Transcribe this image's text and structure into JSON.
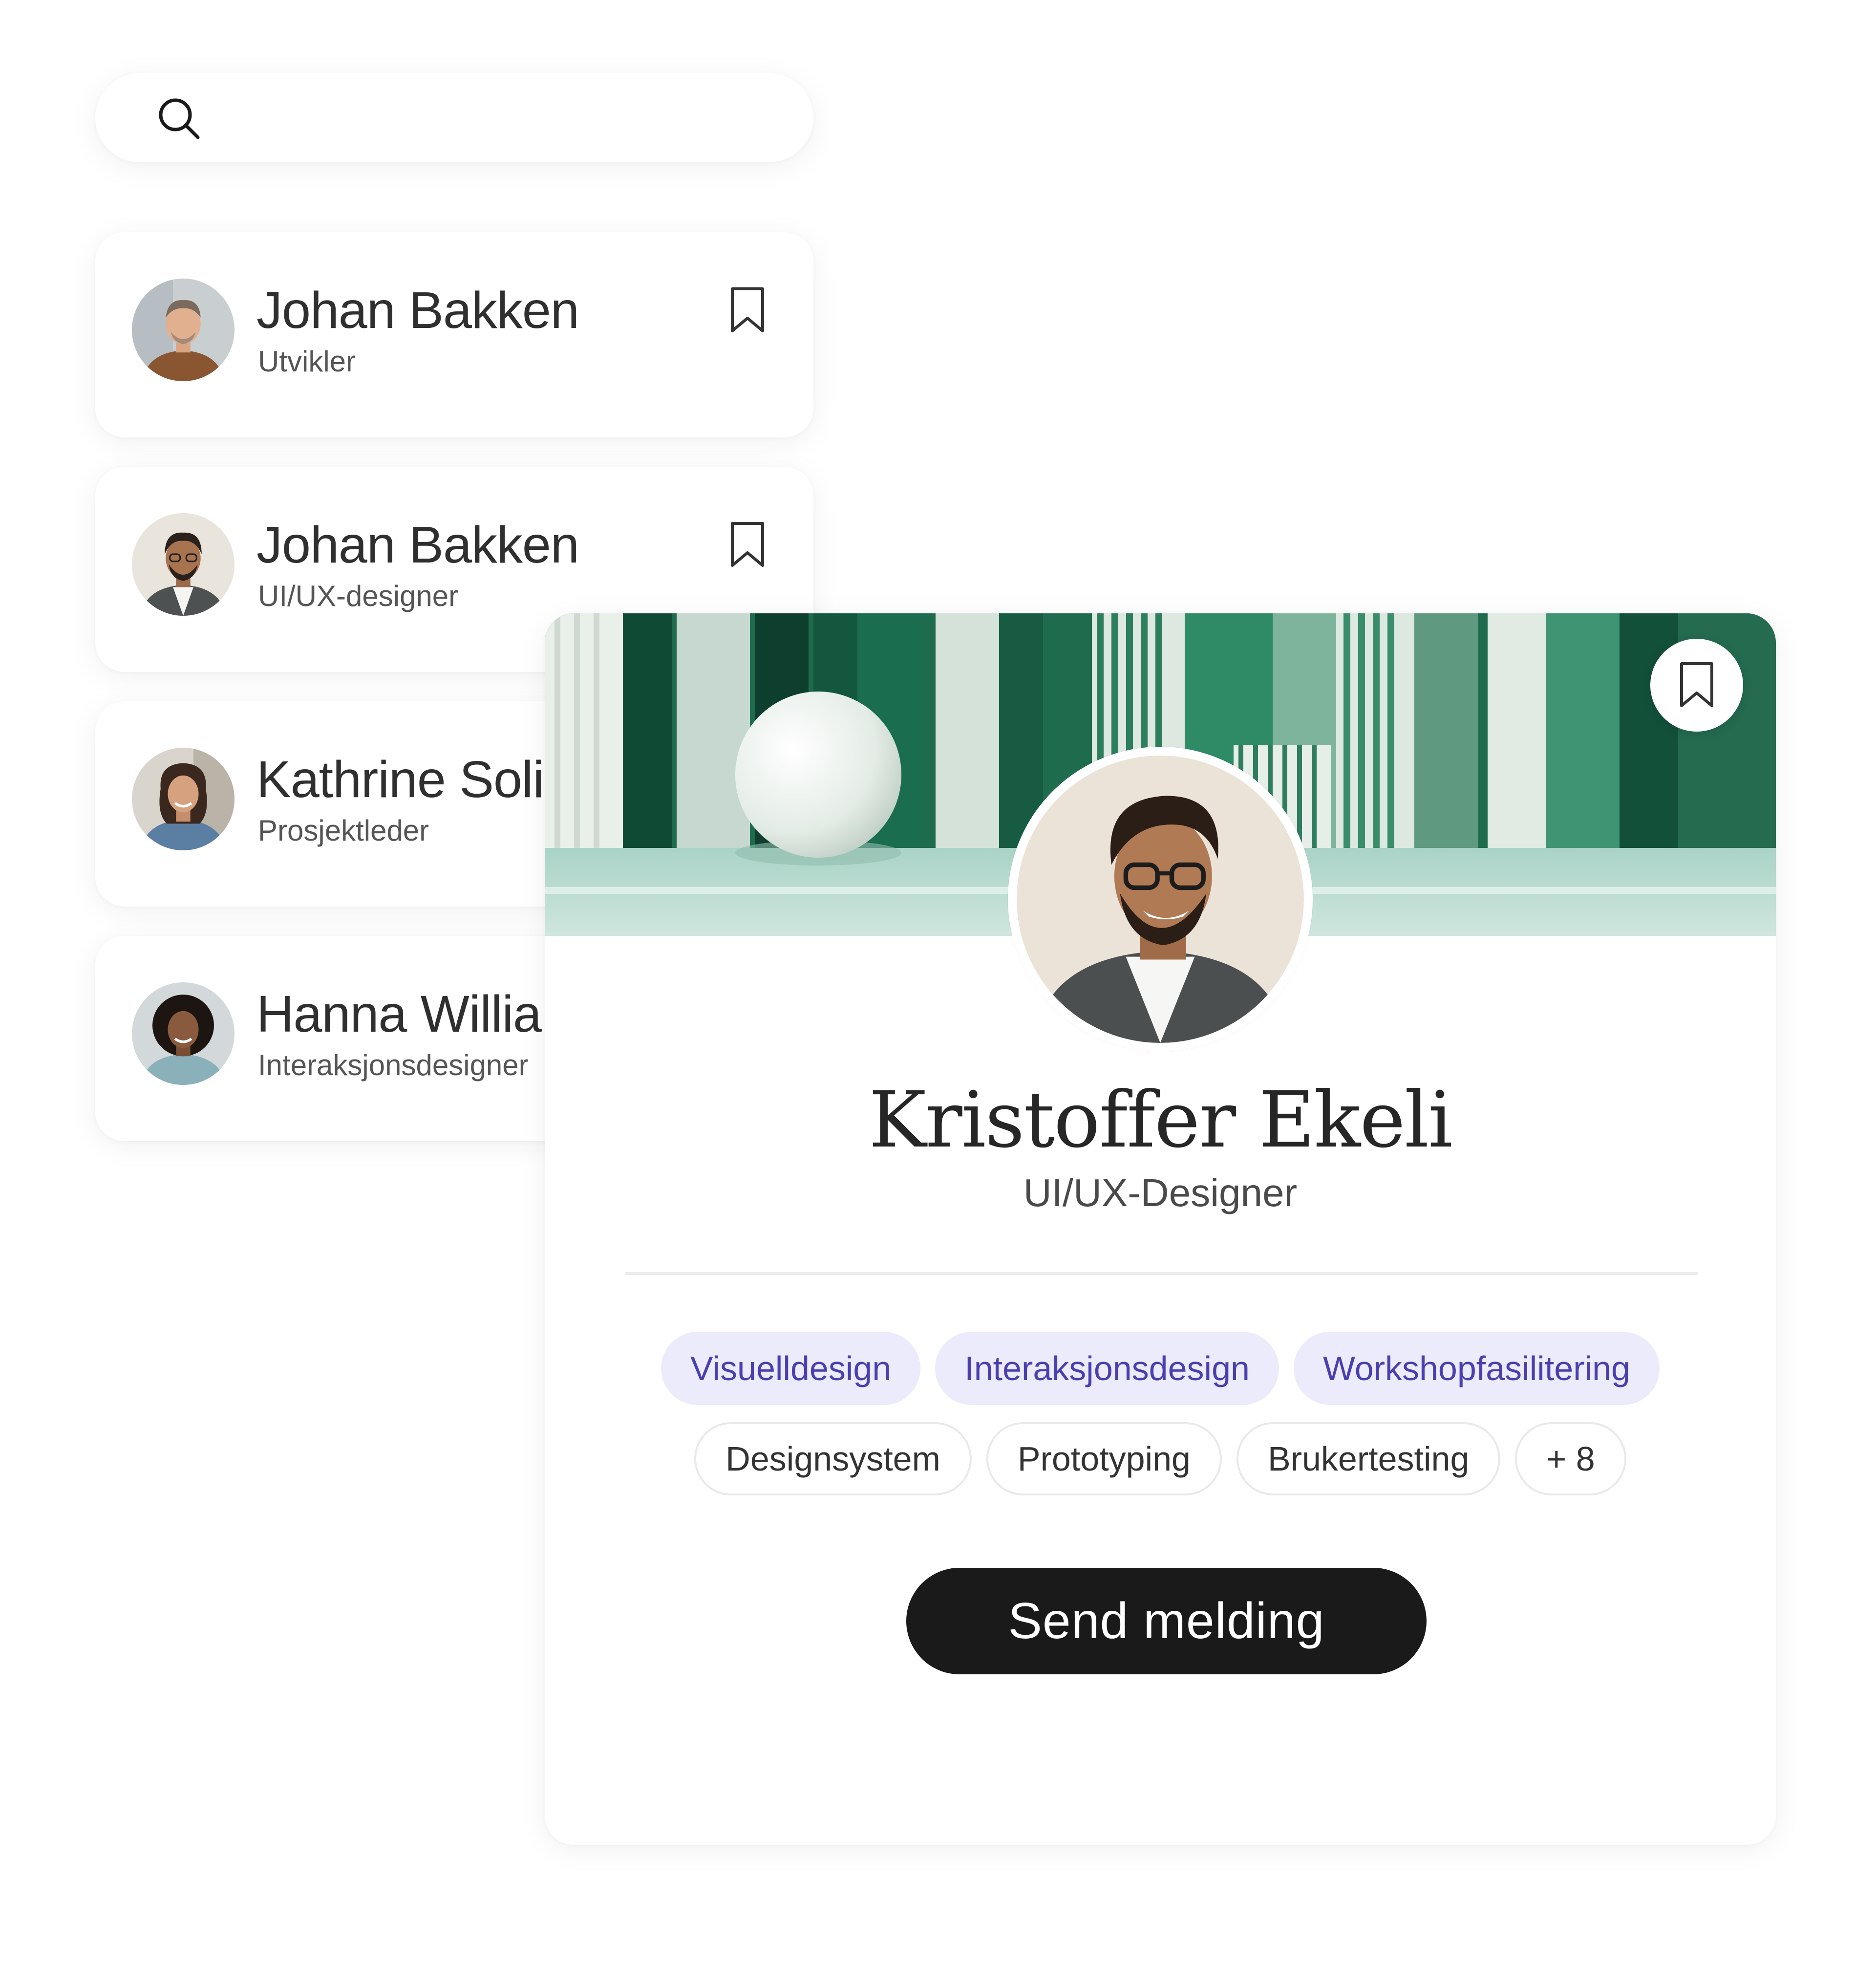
{
  "search": {
    "placeholder": "",
    "icon": "search-icon"
  },
  "people": [
    {
      "name": "Johan Bakken",
      "role": "Utvikler"
    },
    {
      "name": "Johan Bakken",
      "role": "UI/UX-designer"
    },
    {
      "name": "Kathrine Soli",
      "role": "Prosjektleder"
    },
    {
      "name": "Hanna Williams",
      "role": "Interaksjonsdesigner"
    }
  ],
  "profile": {
    "name": "Kristoffer Ekeli",
    "title": "UI/UX-Designer",
    "primary_tags": [
      "Visuelldesign",
      "Interaksjonsdesign",
      "Workshopfasilitering"
    ],
    "tags": [
      "Designsystem",
      "Prototyping",
      "Brukertesting",
      "+ 8"
    ],
    "action_label": "Send melding"
  },
  "colors": {
    "accent_tag_bg": "#ebebfb",
    "accent_tag_text": "#4a3fb0",
    "button_bg": "#1a1a1a",
    "cover_green": "#1f6b4e"
  }
}
